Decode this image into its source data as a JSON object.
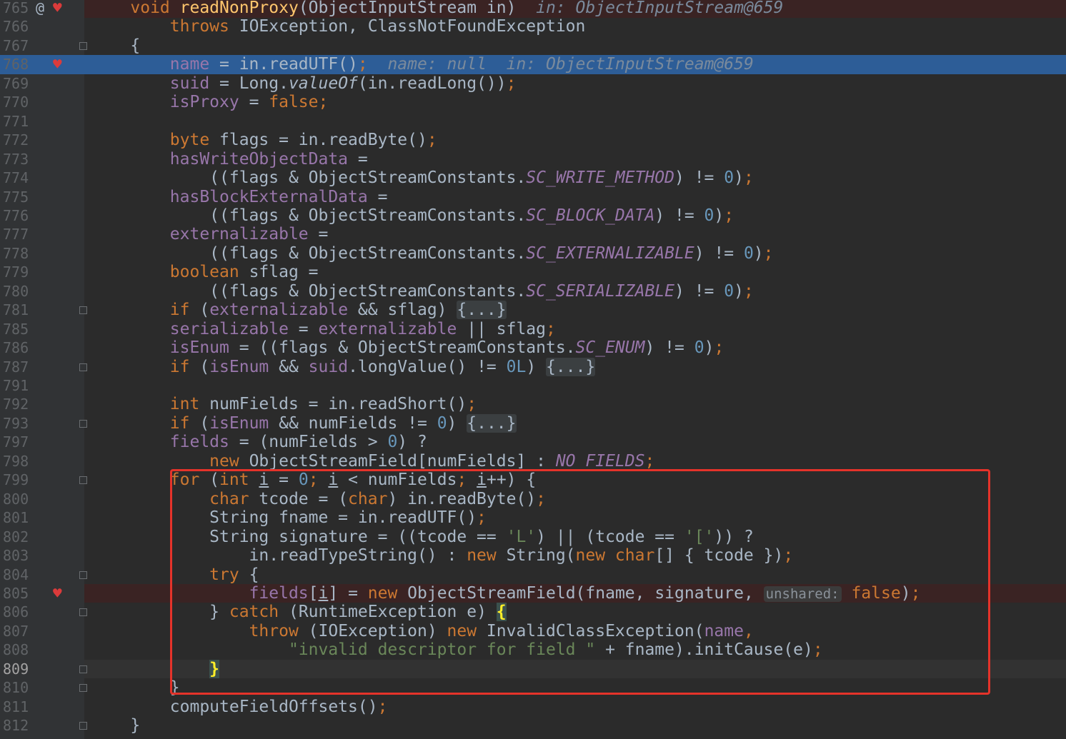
{
  "editor": {
    "colors": {
      "background": "#2b2b2b",
      "gutter": "#313335",
      "execution_line": "#2d5d97",
      "breakpoint_line": "#3a2323",
      "highlight_box": "#e5332a"
    },
    "current_line": "809",
    "lines": [
      {
        "num": "765",
        "kind": "bp",
        "icons": [
          "at-icon",
          "breakpoint-icon"
        ],
        "tokens": [
          [
            "    ",
            "t"
          ],
          [
            "void ",
            "kw"
          ],
          [
            "readNonProxy",
            "fn"
          ],
          [
            "(ObjectInputStream in)",
            "t"
          ],
          [
            "  in: ObjectInputStream@659",
            "hint"
          ]
        ]
      },
      {
        "num": "766",
        "tokens": [
          [
            "        ",
            "t"
          ],
          [
            "throws ",
            "kw"
          ],
          [
            "IOException, ClassNotFoundException",
            "t"
          ]
        ]
      },
      {
        "num": "767",
        "fold": true,
        "tokens": [
          [
            "    {",
            "t"
          ]
        ]
      },
      {
        "num": "768",
        "kind": "exec",
        "icons": [
          "breakpoint-icon"
        ],
        "tokens": [
          [
            "        ",
            "t"
          ],
          [
            "name",
            "fld"
          ],
          [
            " = in.readUTF()",
            "t"
          ],
          [
            ";",
            "kw"
          ],
          [
            "  name: null  in: ObjectInputStream@659",
            "hintx"
          ]
        ]
      },
      {
        "num": "769",
        "tokens": [
          [
            "        ",
            "t"
          ],
          [
            "suid",
            "fld"
          ],
          [
            " = Long.",
            "t"
          ],
          [
            "valueOf",
            "it"
          ],
          [
            "(in.readLong())",
            "t"
          ],
          [
            ";",
            "kw"
          ]
        ]
      },
      {
        "num": "770",
        "tokens": [
          [
            "        ",
            "t"
          ],
          [
            "isProxy",
            "fld"
          ],
          [
            " = ",
            "t"
          ],
          [
            "false",
            "kw"
          ],
          [
            ";",
            "kw"
          ]
        ]
      },
      {
        "num": "771",
        "tokens": []
      },
      {
        "num": "772",
        "tokens": [
          [
            "        ",
            "t"
          ],
          [
            "byte ",
            "kw"
          ],
          [
            "flags = in.readByte()",
            "t"
          ],
          [
            ";",
            "kw"
          ]
        ]
      },
      {
        "num": "773",
        "tokens": [
          [
            "        ",
            "t"
          ],
          [
            "hasWriteObjectData",
            "fld"
          ],
          [
            " =",
            "t"
          ]
        ]
      },
      {
        "num": "774",
        "tokens": [
          [
            "            ((flags & ObjectStreamConstants.",
            "t"
          ],
          [
            "SC_WRITE_METHOD",
            "fldi"
          ],
          [
            ") != ",
            "t"
          ],
          [
            "0",
            "num"
          ],
          [
            ")",
            "t"
          ],
          [
            ";",
            "kw"
          ]
        ]
      },
      {
        "num": "775",
        "tokens": [
          [
            "        ",
            "t"
          ],
          [
            "hasBlockExternalData",
            "fld"
          ],
          [
            " =",
            "t"
          ]
        ]
      },
      {
        "num": "776",
        "tokens": [
          [
            "            ((flags & ObjectStreamConstants.",
            "t"
          ],
          [
            "SC_BLOCK_DATA",
            "fldi"
          ],
          [
            ") != ",
            "t"
          ],
          [
            "0",
            "num"
          ],
          [
            ")",
            "t"
          ],
          [
            ";",
            "kw"
          ]
        ]
      },
      {
        "num": "777",
        "tokens": [
          [
            "        ",
            "t"
          ],
          [
            "externalizable",
            "fld"
          ],
          [
            " =",
            "t"
          ]
        ]
      },
      {
        "num": "778",
        "tokens": [
          [
            "            ((flags & ObjectStreamConstants.",
            "t"
          ],
          [
            "SC_EXTERNALIZABLE",
            "fldi"
          ],
          [
            ") != ",
            "t"
          ],
          [
            "0",
            "num"
          ],
          [
            ")",
            "t"
          ],
          [
            ";",
            "kw"
          ]
        ]
      },
      {
        "num": "779",
        "tokens": [
          [
            "        ",
            "t"
          ],
          [
            "boolean ",
            "kw"
          ],
          [
            "sflag =",
            "t"
          ]
        ]
      },
      {
        "num": "780",
        "tokens": [
          [
            "            ((flags & ObjectStreamConstants.",
            "t"
          ],
          [
            "SC_SERIALIZABLE",
            "fldi"
          ],
          [
            ") != ",
            "t"
          ],
          [
            "0",
            "num"
          ],
          [
            ")",
            "t"
          ],
          [
            ";",
            "kw"
          ]
        ]
      },
      {
        "num": "781",
        "fold": true,
        "tokens": [
          [
            "        ",
            "t"
          ],
          [
            "if ",
            "kw"
          ],
          [
            "(",
            "t"
          ],
          [
            "externalizable",
            "fld"
          ],
          [
            " && sflag) ",
            "t"
          ],
          [
            "{...}",
            "fold"
          ]
        ]
      },
      {
        "num": "785",
        "tokens": [
          [
            "        ",
            "t"
          ],
          [
            "serializable",
            "fld"
          ],
          [
            " = ",
            "t"
          ],
          [
            "externalizable",
            "fld"
          ],
          [
            " || sflag",
            "t"
          ],
          [
            ";",
            "kw"
          ]
        ]
      },
      {
        "num": "786",
        "tokens": [
          [
            "        ",
            "t"
          ],
          [
            "isEnum",
            "fld"
          ],
          [
            " = ((flags & ObjectStreamConstants.",
            "t"
          ],
          [
            "SC_ENUM",
            "fldi"
          ],
          [
            ") != ",
            "t"
          ],
          [
            "0",
            "num"
          ],
          [
            ")",
            "t"
          ],
          [
            ";",
            "kw"
          ]
        ]
      },
      {
        "num": "787",
        "fold": true,
        "tokens": [
          [
            "        ",
            "t"
          ],
          [
            "if ",
            "kw"
          ],
          [
            "(",
            "t"
          ],
          [
            "isEnum",
            "fld"
          ],
          [
            " && ",
            "t"
          ],
          [
            "suid",
            "fld"
          ],
          [
            ".longValue() != ",
            "t"
          ],
          [
            "0L",
            "num"
          ],
          [
            ") ",
            "t"
          ],
          [
            "{...}",
            "fold"
          ]
        ]
      },
      {
        "num": "791",
        "tokens": []
      },
      {
        "num": "792",
        "tokens": [
          [
            "        ",
            "t"
          ],
          [
            "int ",
            "kw"
          ],
          [
            "numFields = in.readShort()",
            "t"
          ],
          [
            ";",
            "kw"
          ]
        ]
      },
      {
        "num": "793",
        "fold": true,
        "tokens": [
          [
            "        ",
            "t"
          ],
          [
            "if ",
            "kw"
          ],
          [
            "(",
            "t"
          ],
          [
            "isEnum",
            "fld"
          ],
          [
            " && numFields != ",
            "t"
          ],
          [
            "0",
            "num"
          ],
          [
            ") ",
            "t"
          ],
          [
            "{...}",
            "fold"
          ]
        ]
      },
      {
        "num": "797",
        "tokens": [
          [
            "        ",
            "t"
          ],
          [
            "fields",
            "fld"
          ],
          [
            " = (numFields > ",
            "t"
          ],
          [
            "0",
            "num"
          ],
          [
            ") ?",
            "t"
          ]
        ]
      },
      {
        "num": "798",
        "tokens": [
          [
            "            ",
            "t"
          ],
          [
            "new ",
            "kw"
          ],
          [
            "ObjectStreamField[numFields] : ",
            "t"
          ],
          [
            "NO_FIELDS",
            "fldi"
          ],
          [
            ";",
            "kw"
          ]
        ]
      },
      {
        "num": "799",
        "fold": true,
        "tokens": [
          [
            "        ",
            "t"
          ],
          [
            "for ",
            "kw"
          ],
          [
            "(",
            "t"
          ],
          [
            "int ",
            "kw"
          ],
          [
            "i",
            "ul"
          ],
          [
            " = ",
            "t"
          ],
          [
            "0",
            "num"
          ],
          [
            "; ",
            "kw"
          ],
          [
            "i",
            "ul"
          ],
          [
            " < numFields",
            "t"
          ],
          [
            "; ",
            "kw"
          ],
          [
            "i",
            "ul"
          ],
          [
            "++) {",
            "t"
          ]
        ]
      },
      {
        "num": "800",
        "tokens": [
          [
            "            ",
            "t"
          ],
          [
            "char ",
            "kw"
          ],
          [
            "tcode = (",
            "t"
          ],
          [
            "char",
            "kw"
          ],
          [
            ") in.readByte()",
            "t"
          ],
          [
            ";",
            "kw"
          ]
        ]
      },
      {
        "num": "801",
        "tokens": [
          [
            "            String fname = in.readUTF()",
            "t"
          ],
          [
            ";",
            "kw"
          ]
        ]
      },
      {
        "num": "802",
        "tokens": [
          [
            "            String signature = ((tcode == ",
            "t"
          ],
          [
            "'L'",
            "str"
          ],
          [
            ") || (tcode == ",
            "t"
          ],
          [
            "'['",
            "str"
          ],
          [
            ")) ?",
            "t"
          ]
        ]
      },
      {
        "num": "803",
        "tokens": [
          [
            "                in.readTypeString() : ",
            "t"
          ],
          [
            "new ",
            "kw"
          ],
          [
            "String(",
            "t"
          ],
          [
            "new char",
            "kw"
          ],
          [
            "[] { tcode })",
            "t"
          ],
          [
            ";",
            "kw"
          ]
        ]
      },
      {
        "num": "804",
        "fold": true,
        "tokens": [
          [
            "            ",
            "t"
          ],
          [
            "try ",
            "kw"
          ],
          [
            "{",
            "t"
          ]
        ]
      },
      {
        "num": "805",
        "kind": "bp",
        "icons": [
          "breakpoint-icon"
        ],
        "tokens": [
          [
            "                ",
            "t"
          ],
          [
            "fields",
            "fld"
          ],
          [
            "[",
            "t"
          ],
          [
            "i",
            "ul"
          ],
          [
            "] = ",
            "t"
          ],
          [
            "new ",
            "kw"
          ],
          [
            "ObjectStreamField(fname, signature, ",
            "t"
          ],
          [
            "unshared:",
            "param"
          ],
          [
            " ",
            "t"
          ],
          [
            "false",
            "kw"
          ],
          [
            ")",
            "t"
          ],
          [
            ";",
            "kw"
          ]
        ]
      },
      {
        "num": "806",
        "fold": true,
        "tokens": [
          [
            "            } ",
            "t"
          ],
          [
            "catch ",
            "kw"
          ],
          [
            "(RuntimeException e) ",
            "t"
          ],
          [
            "{",
            "bry"
          ]
        ]
      },
      {
        "num": "807",
        "tokens": [
          [
            "                ",
            "t"
          ],
          [
            "throw ",
            "kw"
          ],
          [
            "(IOException) ",
            "t"
          ],
          [
            "new ",
            "kw"
          ],
          [
            "InvalidClassException(",
            "t"
          ],
          [
            "name",
            "fld"
          ],
          [
            ",",
            "kw"
          ]
        ]
      },
      {
        "num": "808",
        "tokens": [
          [
            "                    ",
            "t"
          ],
          [
            "\"invalid descriptor for field \"",
            "str"
          ],
          [
            " + fname).initCause(e)",
            "t"
          ],
          [
            ";",
            "kw"
          ]
        ]
      },
      {
        "num": "809",
        "kind": "cur",
        "fold": true,
        "tokens": [
          [
            "            ",
            "t"
          ],
          [
            "}",
            "bry"
          ]
        ]
      },
      {
        "num": "810",
        "fold": true,
        "tokens": [
          [
            "        }",
            "t"
          ]
        ]
      },
      {
        "num": "811",
        "tokens": [
          [
            "        computeFieldOffsets()",
            "t"
          ],
          [
            ";",
            "kw"
          ]
        ]
      },
      {
        "num": "812",
        "fold": true,
        "tokens": [
          [
            "    }",
            "t"
          ]
        ]
      }
    ]
  }
}
